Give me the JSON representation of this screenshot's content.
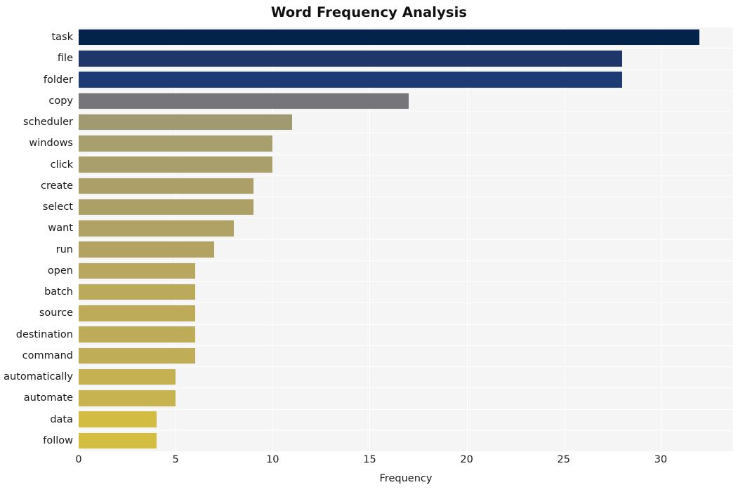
{
  "chart_data": {
    "type": "bar",
    "orientation": "horizontal",
    "title": "Word Frequency Analysis",
    "xlabel": "Frequency",
    "ylabel": "",
    "categories": [
      "task",
      "file",
      "folder",
      "copy",
      "scheduler",
      "windows",
      "click",
      "create",
      "select",
      "want",
      "run",
      "open",
      "batch",
      "source",
      "destination",
      "command",
      "automatically",
      "automate",
      "data",
      "follow"
    ],
    "values": [
      32,
      28,
      28,
      17,
      11,
      10,
      10,
      9,
      9,
      8,
      7,
      6,
      6,
      6,
      6,
      6,
      5,
      5,
      4,
      4
    ],
    "bar_colors": [
      "#04234a",
      "#1e3669",
      "#1e3b74",
      "#75757a",
      "#a09a72",
      "#a89f6f",
      "#a99f6d",
      "#ac9f68",
      "#ada067",
      "#b0a165",
      "#b3a362",
      "#b8a75e",
      "#bba95c",
      "#bdab5a",
      "#bfac59",
      "#c0ad57",
      "#c5b151",
      "#c7b34f",
      "#d2bc42",
      "#d4be40"
    ],
    "xlim": [
      0,
      33.73
    ],
    "xticks": [
      0,
      5,
      10,
      15,
      20,
      25,
      30
    ],
    "xtick_labels": [
      "0",
      "5",
      "10",
      "15",
      "20",
      "25",
      "30"
    ],
    "grid": true,
    "grid_color": "#ffffff",
    "plot_background": "#f5f5f6",
    "figure_background": "#ffffff",
    "legend": null
  }
}
